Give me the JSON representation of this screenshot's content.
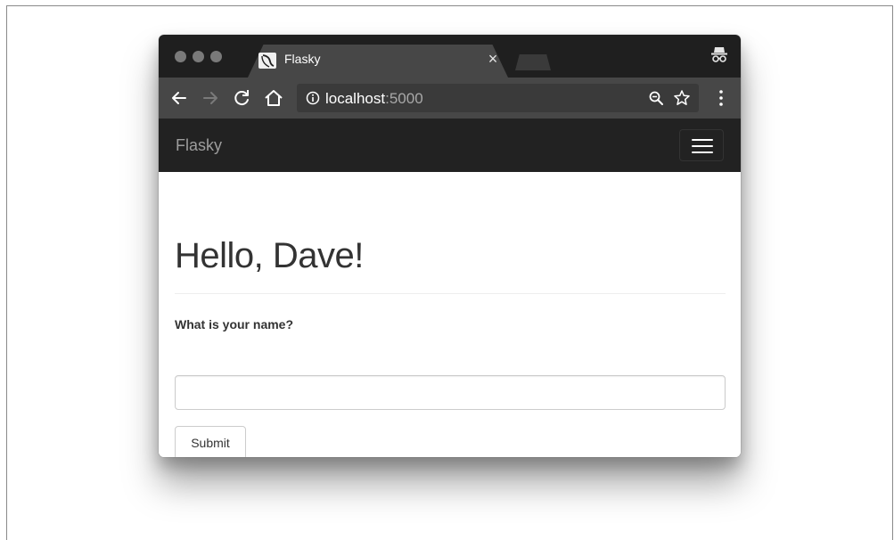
{
  "browser": {
    "tab": {
      "title": "Flasky",
      "close_glyph": "×"
    },
    "address": {
      "host": "localhost",
      "port": ":5000"
    },
    "icons": [
      "back-arrow-icon",
      "forward-arrow-icon",
      "reload-icon",
      "home-icon",
      "info-icon",
      "zoom-out-icon",
      "star-icon",
      "menu-dots-icon",
      "incognito-icon"
    ]
  },
  "navbar": {
    "brand": "Flasky"
  },
  "page": {
    "heading": "Hello, Dave!",
    "form": {
      "label": "What is your name?",
      "input_value": "",
      "submit_label": "Submit"
    }
  },
  "colors": {
    "titlebar": "#1f1f1f",
    "toolbar": "#474747",
    "navbar": "#222222",
    "brand_text": "#9d9d9d",
    "heading_text": "#333333"
  }
}
